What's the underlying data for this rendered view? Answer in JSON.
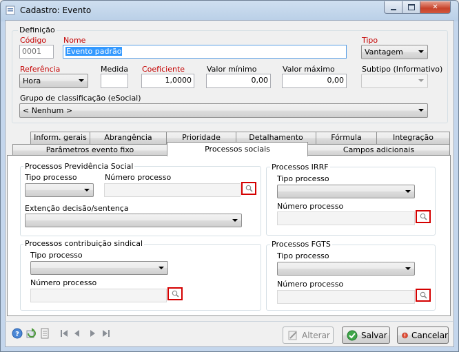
{
  "window": {
    "title": "Cadastro: Evento"
  },
  "definicao": {
    "group_title": "Definição",
    "codigo_label": "Código",
    "codigo_value": "0001",
    "nome_label": "Nome",
    "nome_value": "Evento padrão",
    "tipo_label": "Tipo",
    "tipo_value": "Vantagem",
    "referencia_label": "Referência",
    "referencia_value": "Hora",
    "medida_label": "Medida",
    "medida_value": "",
    "coeficiente_label": "Coeficiente",
    "coeficiente_value": "1,0000",
    "valor_minimo_label": "Valor mínimo",
    "valor_minimo_value": "0,00",
    "valor_maximo_label": "Valor máximo",
    "valor_maximo_value": "0,00",
    "subtipo_label": "Subtipo (Informativo)",
    "subtipo_value": "",
    "grupo_label": "Grupo de classificação (eSocial)",
    "grupo_value": "< Nenhum >"
  },
  "tabs_row1": [
    "Inform. gerais",
    "Abrangência",
    "Prioridade",
    "Detalhamento",
    "Fórmula",
    "Integração"
  ],
  "tabs_row2": [
    "Parâmetros evento fixo",
    "Processos sociais",
    "Campos adicionais"
  ],
  "previdencia": {
    "title": "Processos Previdência Social",
    "tipo_label": "Tipo processo",
    "numero_label": "Número processo",
    "extencao_label": "Extenção decisão/sentença"
  },
  "irrf": {
    "title": "Processos IRRF",
    "tipo_label": "Tipo processo",
    "numero_label": "Número processo"
  },
  "sindical": {
    "title": "Processos contribuição sindical",
    "tipo_label": "Tipo processo",
    "numero_label": "Número processo"
  },
  "fgts": {
    "title": "Processos FGTS",
    "tipo_label": "Tipo processo",
    "numero_label": "Número processo"
  },
  "buttons": {
    "alterar": "Alterar",
    "salvar": "Salvar",
    "cancelar": "Cancelar"
  },
  "toolbar_icons": [
    "help-icon",
    "refresh-icon",
    "document-icon",
    "first-record-icon",
    "previous-record-icon",
    "next-record-icon",
    "last-record-icon"
  ]
}
